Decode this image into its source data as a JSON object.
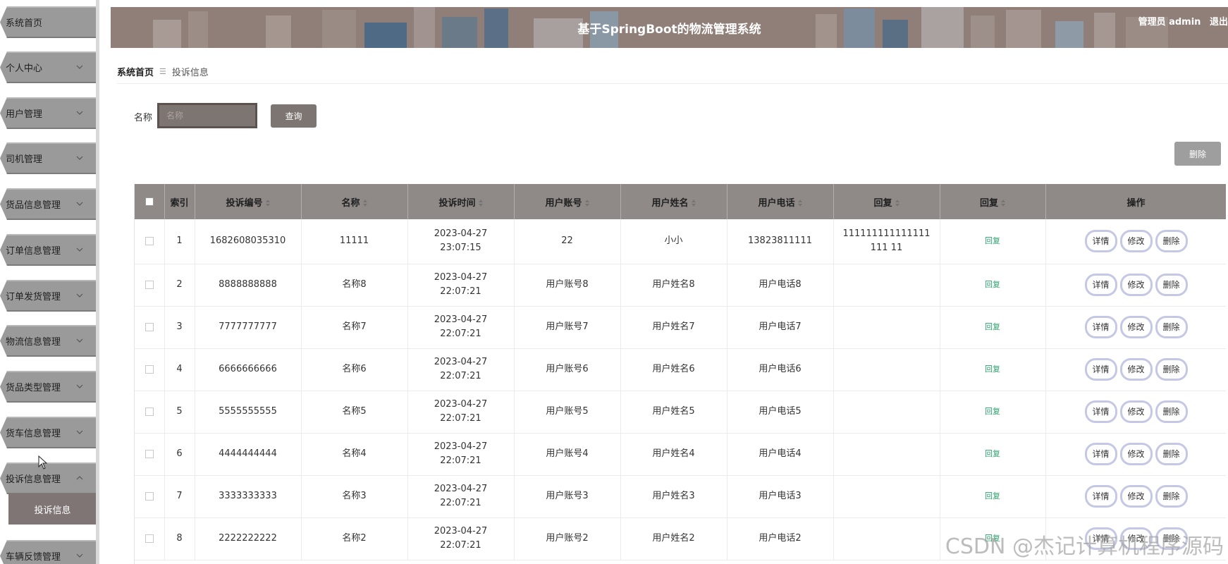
{
  "header": {
    "title": "基于SpringBoot的物流管理系统",
    "user_label": "管理员 admin",
    "logout_label": "退出"
  },
  "sidebar": {
    "items": [
      {
        "label": "系统首页"
      },
      {
        "label": "个人中心"
      },
      {
        "label": "用户管理"
      },
      {
        "label": "司机管理"
      },
      {
        "label": "货品信息管理"
      },
      {
        "label": "订单信息管理"
      },
      {
        "label": "订单发货管理"
      },
      {
        "label": "物流信息管理"
      },
      {
        "label": "货品类型管理"
      },
      {
        "label": "货车信息管理"
      },
      {
        "label": "投诉信息管理"
      },
      {
        "label": "车辆反馈管理"
      }
    ],
    "submenu_label": "投诉信息"
  },
  "breadcrumb": {
    "home": "系统首页",
    "current": "投诉信息"
  },
  "search": {
    "label": "名称",
    "placeholder": "名称",
    "button_label": "查询"
  },
  "toolbar": {
    "delete_label": "删除"
  },
  "table": {
    "columns": [
      "索引",
      "投诉编号",
      "名称",
      "投诉时间",
      "用户账号",
      "用户姓名",
      "用户电话",
      "回复",
      "回复",
      "操作"
    ],
    "rows": [
      {
        "index": "1",
        "code": "1682608035310",
        "name": "11111",
        "time": "2023-04-27 23:07:15",
        "account": "22",
        "username": "小小",
        "phone": "13823811111",
        "reply": "111111111111111111 11",
        "action": "回复"
      },
      {
        "index": "2",
        "code": "8888888888",
        "name": "名称8",
        "time": "2023-04-27 22:07:21",
        "account": "用户账号8",
        "username": "用户姓名8",
        "phone": "用户电话8",
        "reply": "",
        "action": "回复"
      },
      {
        "index": "3",
        "code": "7777777777",
        "name": "名称7",
        "time": "2023-04-27 22:07:21",
        "account": "用户账号7",
        "username": "用户姓名7",
        "phone": "用户电话7",
        "reply": "",
        "action": "回复"
      },
      {
        "index": "4",
        "code": "6666666666",
        "name": "名称6",
        "time": "2023-04-27 22:07:21",
        "account": "用户账号6",
        "username": "用户姓名6",
        "phone": "用户电话6",
        "reply": "",
        "action": "回复"
      },
      {
        "index": "5",
        "code": "5555555555",
        "name": "名称5",
        "time": "2023-04-27 22:07:21",
        "account": "用户账号5",
        "username": "用户姓名5",
        "phone": "用户电话5",
        "reply": "",
        "action": "回复"
      },
      {
        "index": "6",
        "code": "4444444444",
        "name": "名称4",
        "time": "2023-04-27 22:07:21",
        "account": "用户账号4",
        "username": "用户姓名4",
        "phone": "用户电话4",
        "reply": "",
        "action": "回复"
      },
      {
        "index": "7",
        "code": "3333333333",
        "name": "名称3",
        "time": "2023-04-27 22:07:21",
        "account": "用户账号3",
        "username": "用户姓名3",
        "phone": "用户电话3",
        "reply": "",
        "action": "回复"
      },
      {
        "index": "8",
        "code": "2222222222",
        "name": "名称2",
        "time": "2023-04-27 22:07:21",
        "account": "用户账号2",
        "username": "用户姓名2",
        "phone": "用户电话2",
        "reply": "",
        "action": "回复"
      }
    ],
    "row_actions": {
      "detail": "详情",
      "edit": "修改",
      "delete": "删除"
    }
  },
  "watermark": "CSDN @杰记计算机程序源码",
  "colors": {
    "accent": "#7d7572",
    "header_bg": "#8f7f78",
    "sidebar_item_bg": "#9a9a9a",
    "table_header_bg": "#8f8a88",
    "reply_link": "#2d9e6d",
    "op_button_border": "#c5c8e4"
  }
}
